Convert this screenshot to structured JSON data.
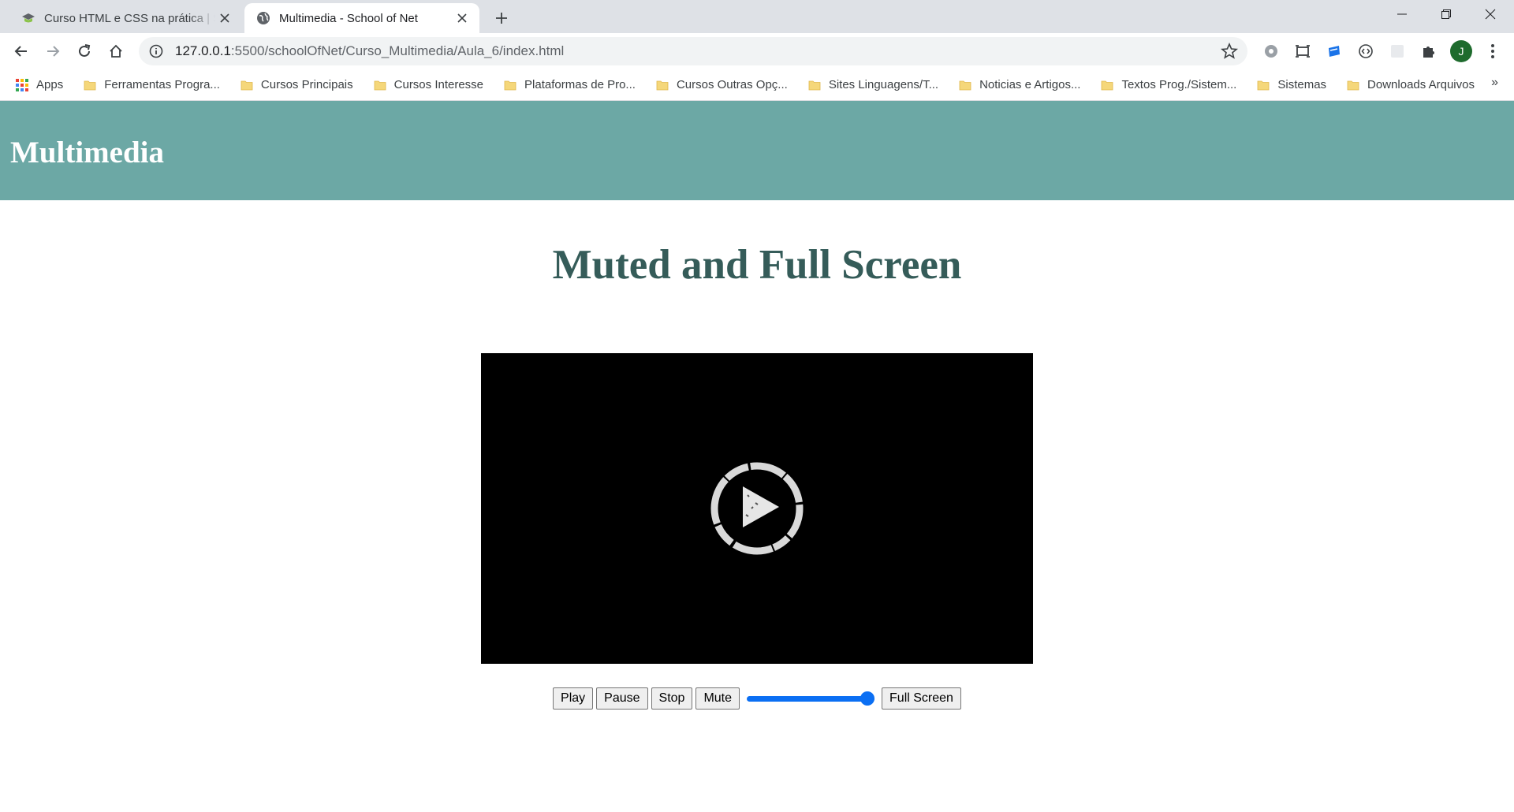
{
  "browser": {
    "tabs": [
      {
        "title": "Curso HTML e CSS na prática | School of Net",
        "active": false
      },
      {
        "title": "Multimedia - School of Net",
        "active": true
      }
    ],
    "address": {
      "host": "127.0.0.1",
      "path": ":5500/schoolOfNet/Curso_Multimedia/Aula_6/index.html"
    },
    "profile_initial": "J",
    "bookmarks": [
      {
        "label": "Apps",
        "type": "apps"
      },
      {
        "label": "Ferramentas Progra...",
        "type": "folder"
      },
      {
        "label": "Cursos Principais",
        "type": "folder"
      },
      {
        "label": "Cursos Interesse",
        "type": "folder"
      },
      {
        "label": "Plataformas de Pro...",
        "type": "folder"
      },
      {
        "label": "Cursos Outras Opç...",
        "type": "folder"
      },
      {
        "label": "Sites Linguagens/T...",
        "type": "folder"
      },
      {
        "label": "Noticias e Artigos...",
        "type": "folder"
      },
      {
        "label": "Textos Prog./Sistem...",
        "type": "folder"
      },
      {
        "label": "Sistemas",
        "type": "folder"
      },
      {
        "label": "Downloads Arquivos",
        "type": "folder"
      }
    ],
    "bookmarks_overflow": "»"
  },
  "page": {
    "header_title": "Multimedia",
    "title": "Muted and Full Screen",
    "controls": {
      "play_label": "Play",
      "pause_label": "Pause",
      "stop_label": "Stop",
      "mute_label": "Mute",
      "volume_value": 1.0,
      "fullscreen_label": "Full Screen"
    }
  },
  "colors": {
    "header_bg": "#6ca8a5",
    "title_text": "#355c59",
    "slider_accent": "#0b6ff3",
    "video_bg": "#000000",
    "folder": "#f5d77a"
  }
}
